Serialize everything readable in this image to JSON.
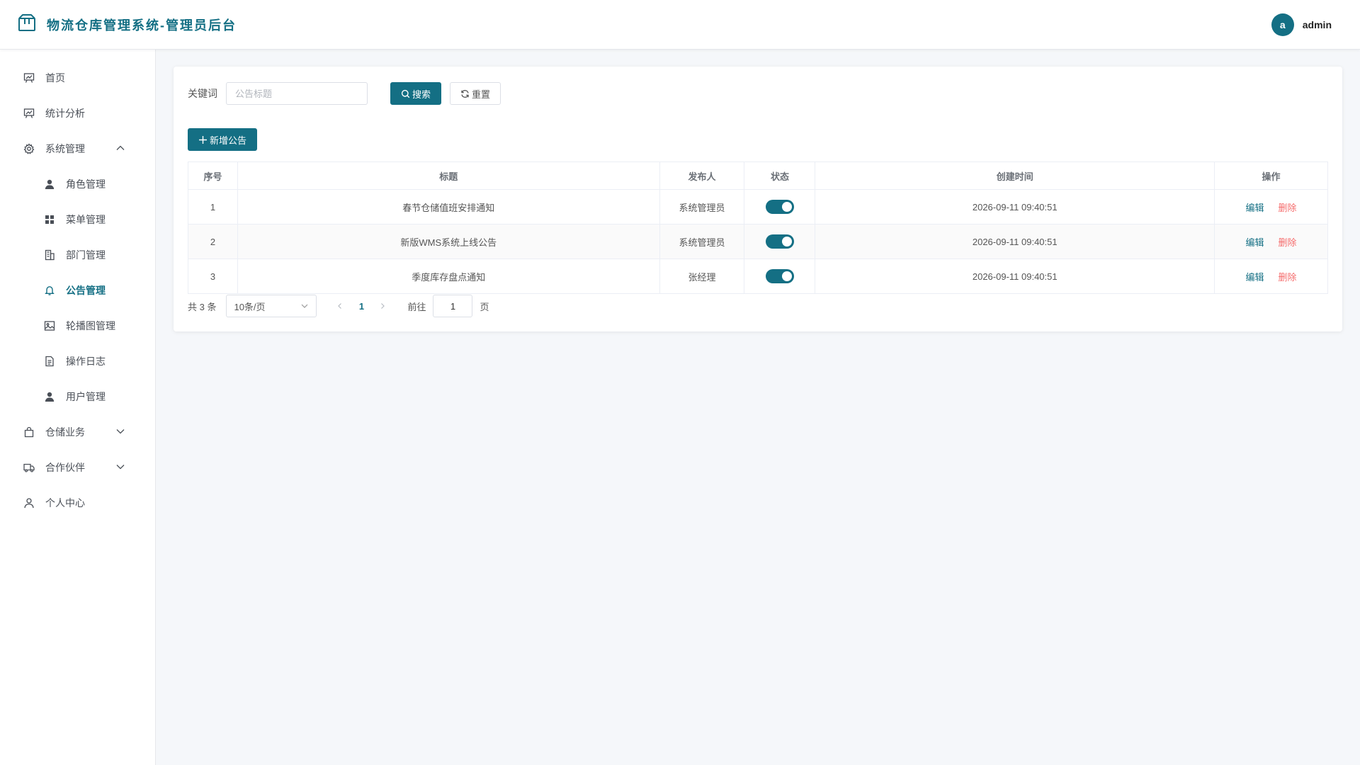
{
  "header": {
    "title": "物流仓库管理系统-管理员后台",
    "logo_icon": "package-box-icon",
    "avatar_initial": "a",
    "username": "admin"
  },
  "sidebar": {
    "items": [
      {
        "label": "首页",
        "icon": "chart-board-icon",
        "level": 1
      },
      {
        "label": "统计分析",
        "icon": "chart-board-icon",
        "level": 1
      },
      {
        "label": "系统管理",
        "icon": "gear-icon",
        "level": 1,
        "expanded": true
      },
      {
        "label": "角色管理",
        "icon": "user-icon",
        "level": 2
      },
      {
        "label": "菜单管理",
        "icon": "grid-icon",
        "level": 2
      },
      {
        "label": "部门管理",
        "icon": "building-icon",
        "level": 2
      },
      {
        "label": "公告管理",
        "icon": "bell-icon",
        "level": 2,
        "active": true
      },
      {
        "label": "轮播图管理",
        "icon": "picture-icon",
        "level": 2
      },
      {
        "label": "操作日志",
        "icon": "document-icon",
        "level": 2
      },
      {
        "label": "用户管理",
        "icon": "user-icon",
        "level": 2
      },
      {
        "label": "仓储业务",
        "icon": "shopping-bag-icon",
        "level": 1,
        "expanded": false
      },
      {
        "label": "合作伙伴",
        "icon": "truck-icon",
        "level": 1,
        "expanded": false
      },
      {
        "label": "个人中心",
        "icon": "user-outline-icon",
        "level": 1
      }
    ]
  },
  "search": {
    "keyword_label": "关键词",
    "keyword_placeholder": "公告标题",
    "keyword_value": "",
    "search_label": "搜索",
    "reset_label": "重置"
  },
  "toolbar": {
    "add_label": "新增公告"
  },
  "table": {
    "columns": [
      "序号",
      "标题",
      "发布人",
      "状态",
      "创建时间",
      "操作"
    ],
    "rows": [
      {
        "no": "1",
        "title": "春节仓储值班安排通知",
        "publisher": "系统管理员",
        "status": true,
        "created": "2026-09-11 09:40:51"
      },
      {
        "no": "2",
        "title": "新版WMS系统上线公告",
        "publisher": "系统管理员",
        "status": true,
        "created": "2026-09-11 09:40:51"
      },
      {
        "no": "3",
        "title": "季度库存盘点通知",
        "publisher": "张经理",
        "status": true,
        "created": "2026-09-11 09:40:51"
      }
    ],
    "edit_label": "编辑",
    "delete_label": "删除"
  },
  "pagination": {
    "total_text": "共 3 条",
    "page_size": "10条/页",
    "current_page": "1",
    "goto_label": "前往",
    "goto_value": "1",
    "page_suffix": "页"
  },
  "colors": {
    "primary": "#146f84",
    "danger": "#f56c6c"
  }
}
